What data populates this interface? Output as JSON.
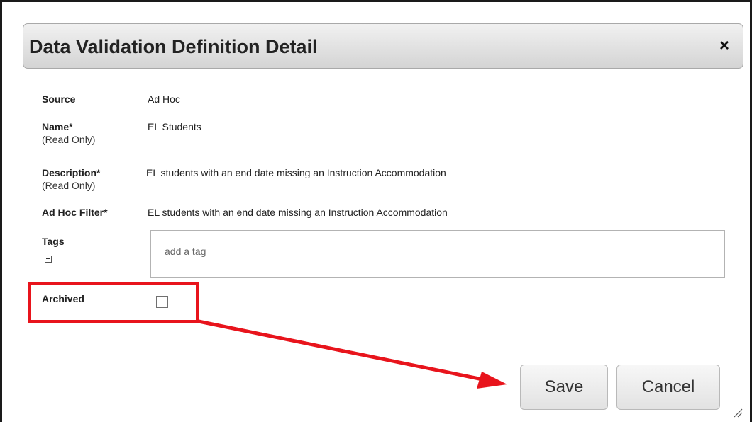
{
  "dialog": {
    "title": "Data Validation Definition Detail",
    "close_symbol": "×"
  },
  "fields": {
    "source": {
      "label": "Source",
      "value": "Ad Hoc"
    },
    "name": {
      "label": "Name*",
      "sublabel": "(Read Only)",
      "value": "EL Students"
    },
    "description": {
      "label": "Description*",
      "sublabel": "(Read Only)",
      "value": "EL students with an end date missing an Instruction Accommodation"
    },
    "filter": {
      "label": "Ad Hoc Filter*",
      "value": "EL students with an end date missing an Instruction Accommodation"
    },
    "tags": {
      "label": "Tags",
      "placeholder": "add a tag",
      "value": ""
    },
    "archived": {
      "label": "Archived",
      "checked": false
    }
  },
  "footer": {
    "save_label": "Save",
    "cancel_label": "Cancel"
  },
  "icons": {
    "close": "close-icon",
    "collapse": "collapse-icon",
    "resize": "resize-grip-icon"
  },
  "annotation": {
    "color": "#e8141c"
  }
}
